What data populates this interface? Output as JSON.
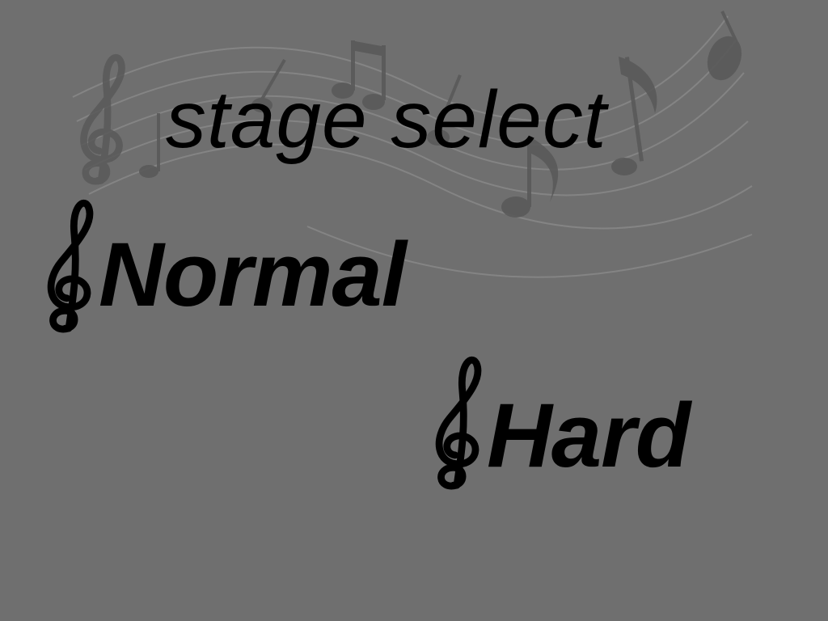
{
  "screen": {
    "title": "stage select",
    "background_color": "#6f6f6f",
    "text_color": "#000000"
  },
  "options": [
    {
      "label": "Normal",
      "icon": "treble-clef-icon"
    },
    {
      "label": "Hard",
      "icon": "treble-clef-icon"
    }
  ],
  "decoration": {
    "background_icons": [
      "music-staff-lines",
      "treble-clef-icon",
      "eighth-note-icon",
      "beamed-notes-icon"
    ]
  }
}
